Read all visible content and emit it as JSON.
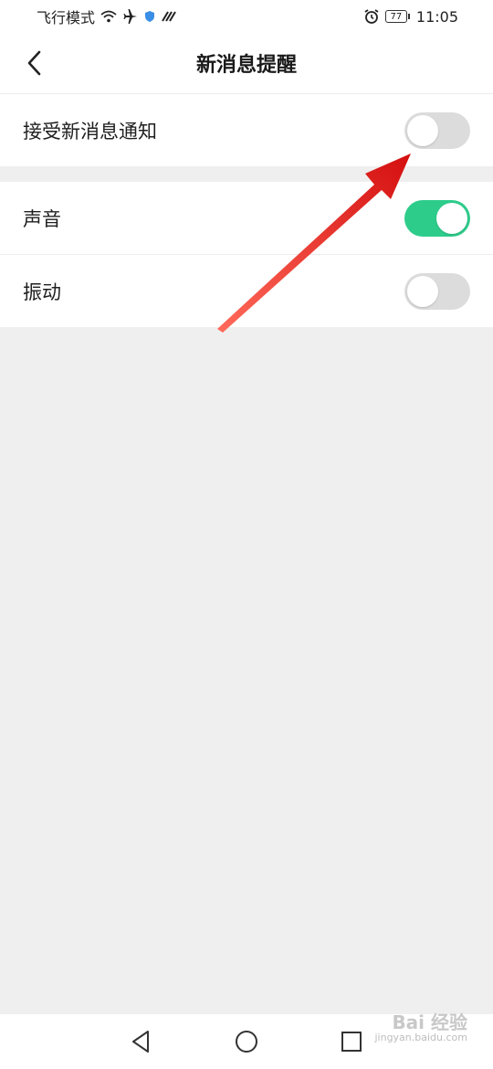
{
  "status_bar": {
    "left_text": "飞行模式",
    "time": "11:05",
    "battery": "77",
    "icons": [
      "wifi-icon",
      "airplane-icon",
      "shield-icon",
      "signal-icon",
      "alarm-icon",
      "battery-icon"
    ]
  },
  "header": {
    "title": "新消息提醒",
    "back_icon": "chevron-left-icon"
  },
  "settings": [
    {
      "label": "接受新消息通知",
      "enabled": false
    },
    {
      "label": "声音",
      "enabled": true
    },
    {
      "label": "振动",
      "enabled": false
    }
  ],
  "colors": {
    "toggle_on": "#2ecc8b",
    "toggle_off": "#dcdcdc",
    "arrow": "#e8201c",
    "background": "#efefef"
  },
  "navbar": {
    "icons": [
      "back-triangle-icon",
      "home-circle-icon",
      "recent-square-icon"
    ]
  },
  "watermark": {
    "brand": "Bai 经验",
    "url": "jingyan.baidu.com"
  }
}
